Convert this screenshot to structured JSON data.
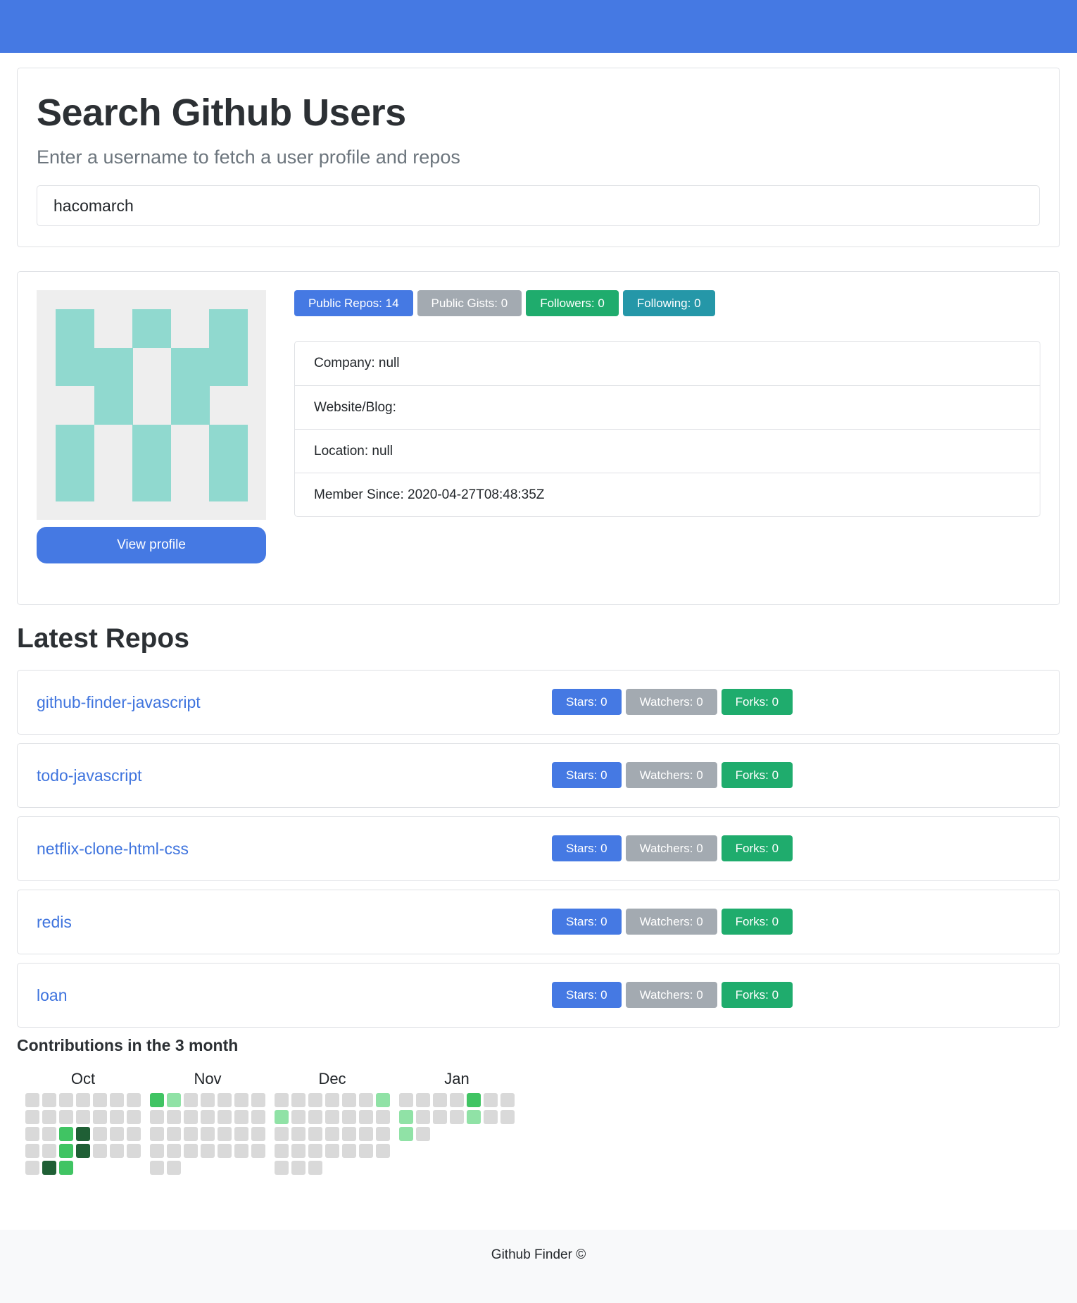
{
  "search": {
    "title": "Search Github Users",
    "subtitle": "Enter a username to fetch a user profile and repos",
    "value": "hacomarch",
    "placeholder": ""
  },
  "profile": {
    "badges": {
      "public_repos": "Public Repos: 14",
      "public_gists": "Public Gists: 0",
      "followers": "Followers: 0",
      "following": "Following: 0"
    },
    "info": {
      "company": "Company: null",
      "website": "Website/Blog:",
      "location": "Location: null",
      "member_since": "Member Since: 2020-04-27T08:48:35Z"
    },
    "view_profile_label": "View profile"
  },
  "repos": {
    "heading": "Latest Repos",
    "items": [
      {
        "name": "github-finder-javascript",
        "stars": "Stars: 0",
        "watchers": "Watchers: 0",
        "forks": "Forks: 0"
      },
      {
        "name": "todo-javascript",
        "stars": "Stars: 0",
        "watchers": "Watchers: 0",
        "forks": "Forks: 0"
      },
      {
        "name": "netflix-clone-html-css",
        "stars": "Stars: 0",
        "watchers": "Watchers: 0",
        "forks": "Forks: 0"
      },
      {
        "name": "redis",
        "stars": "Stars: 0",
        "watchers": "Watchers: 0",
        "forks": "Forks: 0"
      },
      {
        "name": "loan",
        "stars": "Stars: 0",
        "watchers": "Watchers: 0",
        "forks": "Forks: 0"
      }
    ]
  },
  "contributions": {
    "title": "Contributions in the 3 month",
    "levels_colors": [
      "#d9d9d9",
      "#90e2a6",
      "#40c463",
      "#2d9f4f",
      "#1f5f35"
    ],
    "months": [
      {
        "label": "Oct",
        "cells": [
          0,
          0,
          0,
          0,
          0,
          0,
          0,
          0,
          0,
          0,
          0,
          0,
          0,
          0,
          0,
          0,
          2,
          4,
          0,
          0,
          0,
          0,
          0,
          2,
          4,
          0,
          0,
          0,
          0,
          4,
          2
        ]
      },
      {
        "label": "Nov",
        "cells": [
          2,
          1,
          0,
          0,
          0,
          0,
          0,
          0,
          0,
          0,
          0,
          0,
          0,
          0,
          0,
          0,
          0,
          0,
          0,
          0,
          0,
          0,
          0,
          0,
          0,
          0,
          0,
          0,
          0,
          0
        ]
      },
      {
        "label": "Dec",
        "cells": [
          0,
          0,
          0,
          0,
          0,
          0,
          1,
          1,
          0,
          0,
          0,
          0,
          0,
          0,
          0,
          0,
          0,
          0,
          0,
          0,
          0,
          0,
          0,
          0,
          0,
          0,
          0,
          0,
          0,
          0,
          0
        ]
      },
      {
        "label": "Jan",
        "cells": [
          0,
          0,
          0,
          0,
          2,
          0,
          0,
          1,
          0,
          0,
          0,
          1,
          0,
          0,
          1,
          0
        ]
      }
    ]
  },
  "footer": {
    "text": "Github Finder ©"
  }
}
